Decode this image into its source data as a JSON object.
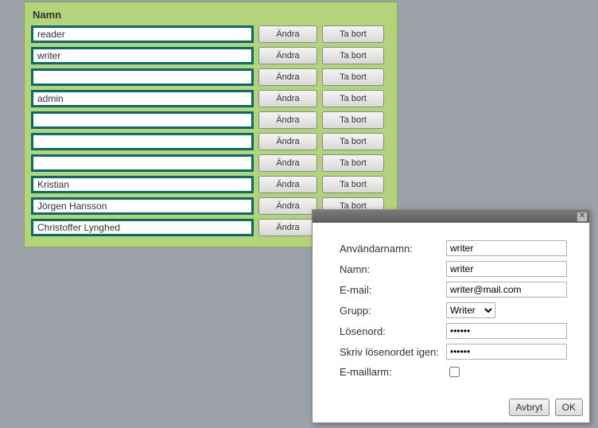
{
  "table": {
    "header": "Namn",
    "edit_label": "Ändra",
    "delete_label": "Ta bort",
    "rows": [
      {
        "name": "reader"
      },
      {
        "name": "writer"
      },
      {
        "name": ""
      },
      {
        "name": "admin"
      },
      {
        "name": ""
      },
      {
        "name": ""
      },
      {
        "name": ""
      },
      {
        "name": "Kristian"
      },
      {
        "name": "Jörgen Hansson"
      },
      {
        "name": "Christoffer Lynghed"
      }
    ]
  },
  "dialog": {
    "labels": {
      "username": "Användarnamn:",
      "name": "Namn:",
      "email": "E-mail:",
      "group": "Grupp:",
      "password": "Lösenord:",
      "password2": "Skriv lösenordet igen:",
      "emailalarm": "E-maillarm:"
    },
    "values": {
      "username": "writer",
      "name": "writer",
      "email": "writer@mail.com",
      "group": "Writer",
      "password": "••••••",
      "password2": "••••••",
      "emailalarm": false
    },
    "buttons": {
      "cancel": "Avbryt",
      "ok": "OK"
    },
    "close_glyph": "✕"
  }
}
